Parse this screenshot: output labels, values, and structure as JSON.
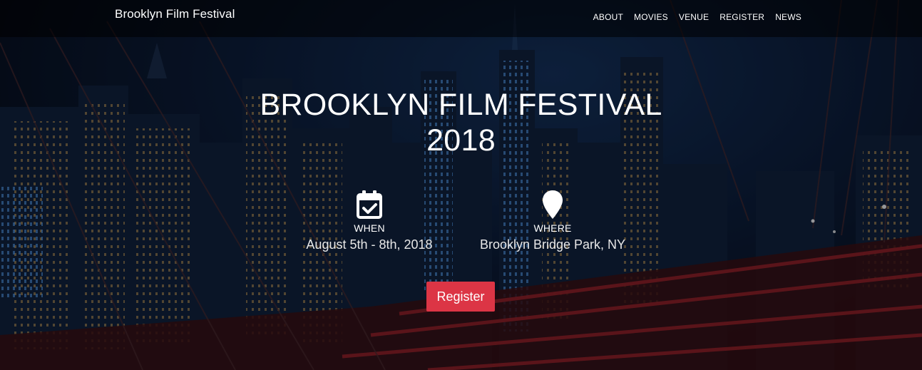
{
  "nav": {
    "brand": "Brooklyn Film Festival",
    "links": [
      "ABOUT",
      "MOVIES",
      "VENUE",
      "REGISTER",
      "NEWS"
    ]
  },
  "hero": {
    "title_line1": "BROOKLYN FILM FESTIVAL",
    "title_line2": "2018",
    "when": {
      "icon": "calendar-check-icon",
      "label": "WHEN",
      "value": "August 5th - 8th, 2018"
    },
    "where": {
      "icon": "map-pin-icon",
      "label": "WHERE",
      "value": "Brooklyn Bridge Park, NY"
    },
    "cta_label": "Register"
  },
  "colors": {
    "accent": "#dc3545",
    "navbar": "#000000",
    "text": "#ffffff"
  }
}
